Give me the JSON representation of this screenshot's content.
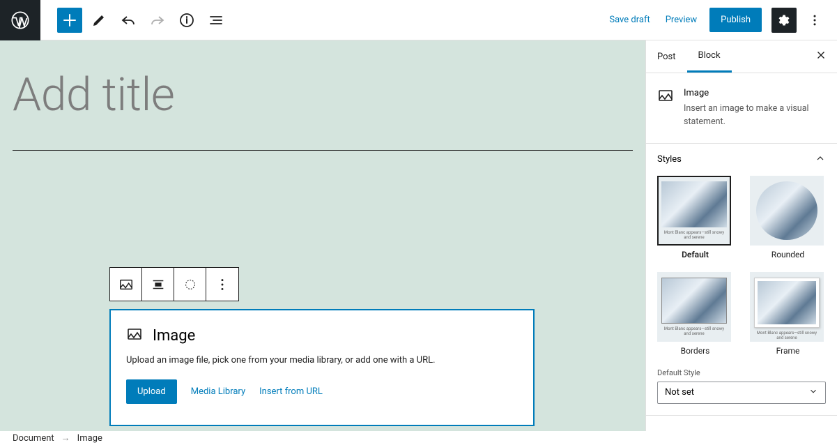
{
  "toolbar": {
    "save_draft": "Save draft",
    "preview": "Preview",
    "publish": "Publish"
  },
  "editor": {
    "title_placeholder": "Add title"
  },
  "image_block": {
    "title": "Image",
    "description": "Upload an image file, pick one from your media library, or add one with a URL.",
    "upload": "Upload",
    "media_library": "Media Library",
    "insert_url": "Insert from URL"
  },
  "sidebar": {
    "tabs": {
      "post": "Post",
      "block": "Block"
    },
    "block_info": {
      "title": "Image",
      "description": "Insert an image to make a visual statement."
    },
    "styles": {
      "heading": "Styles",
      "options": [
        "Default",
        "Rounded",
        "Borders",
        "Frame"
      ],
      "selected": "Default",
      "default_style_label": "Default Style",
      "default_style_value": "Not set"
    }
  },
  "breadcrumb": {
    "document": "Document",
    "current": "Image"
  }
}
